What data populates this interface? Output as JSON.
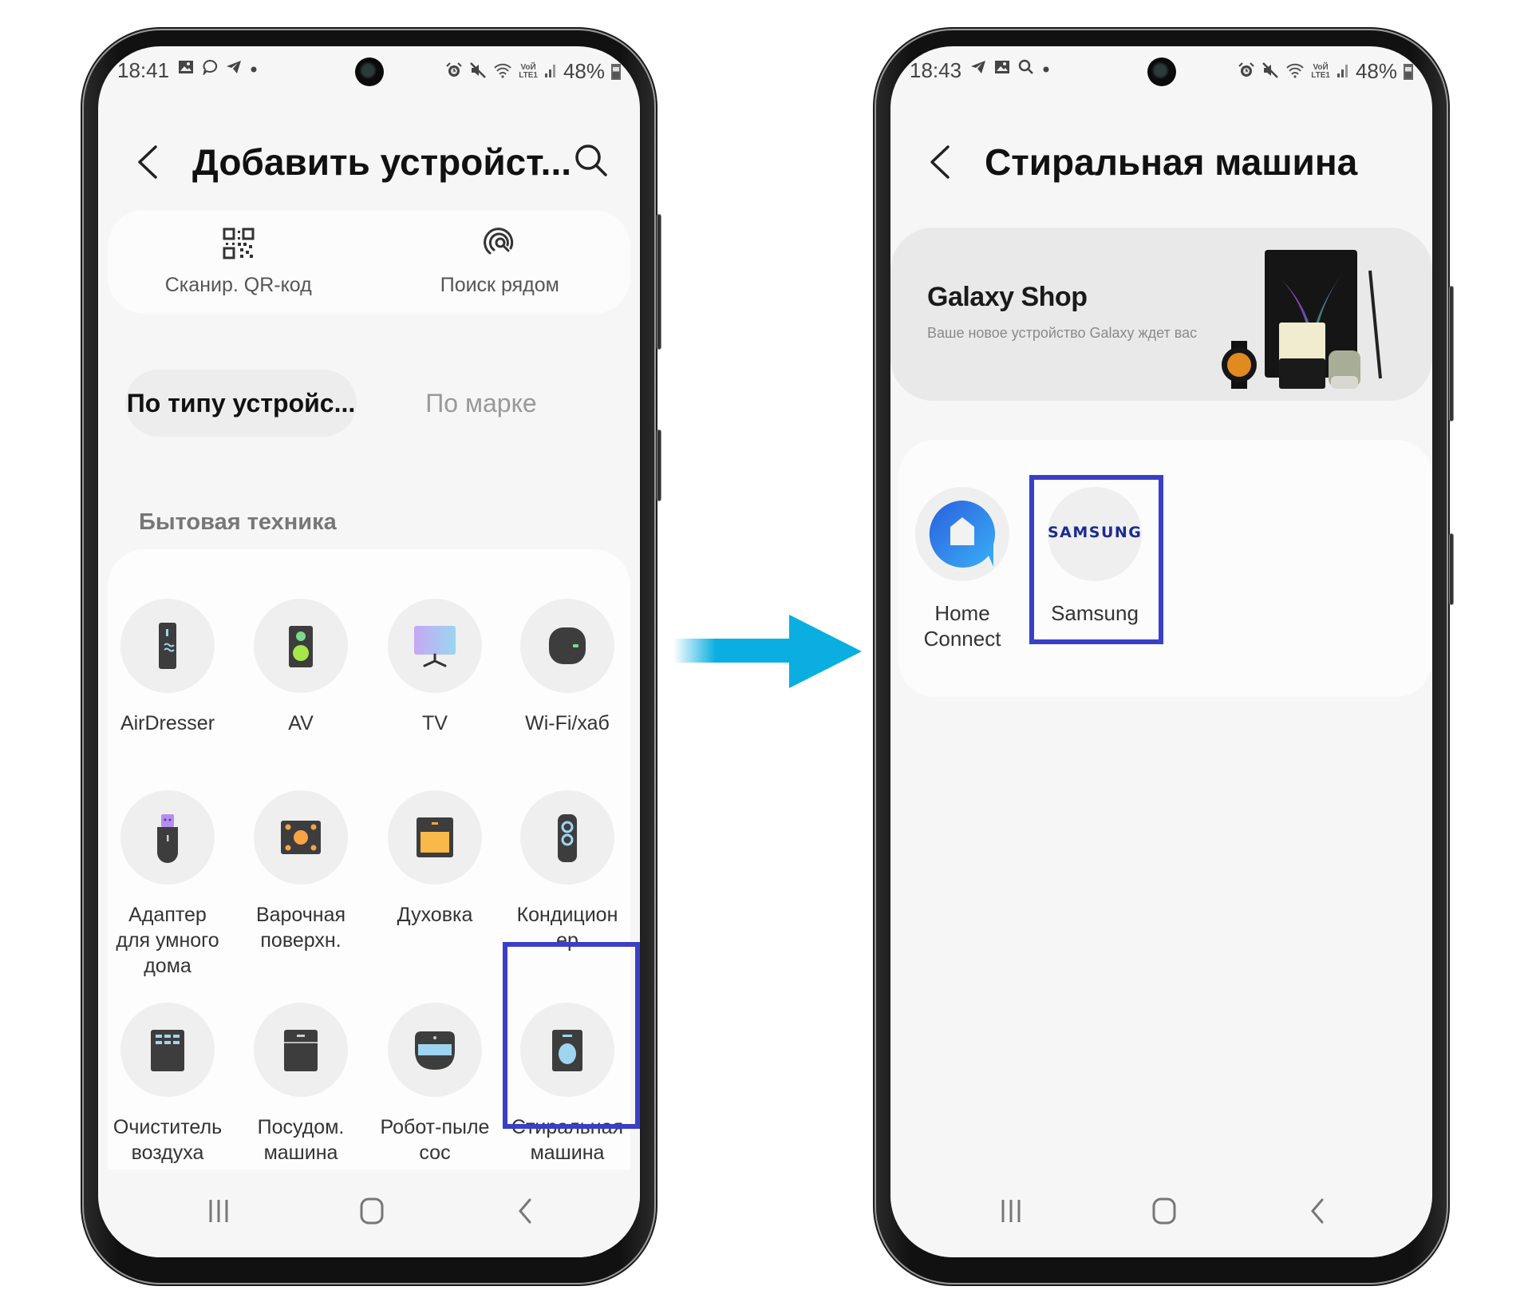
{
  "left_phone": {
    "status": {
      "time": "18:41",
      "left_icons": [
        "gallery-icon",
        "chat-bubble-icon",
        "telegram-icon",
        "dot-icon"
      ],
      "right_icons": [
        "alarm-icon",
        "mute-icon",
        "wifi-icon",
        "volte-lte-icon",
        "signal-icon"
      ],
      "volte_label_top": "VoЙ",
      "volte_label_bottom": "LTE1",
      "battery": "48%"
    },
    "header": {
      "title": "Добавить устройст..."
    },
    "quick_actions": [
      {
        "label": "Сканир. QR-код",
        "icon": "qr-code-icon"
      },
      {
        "label": "Поиск рядом",
        "icon": "nearby-scan-icon"
      }
    ],
    "tabs": [
      {
        "label": "По типу устройс...",
        "active": true
      },
      {
        "label": "По марке",
        "active": false
      }
    ],
    "section_label": "Бытовая техника",
    "devices": [
      {
        "label": "AirDresser",
        "icon": "airdresser-icon"
      },
      {
        "label": "AV",
        "icon": "speaker-icon"
      },
      {
        "label": "TV",
        "icon": "tv-icon"
      },
      {
        "label": "Wi-Fi/хаб",
        "icon": "wifi-hub-icon"
      },
      {
        "label": "Адаптер для умного дома",
        "icon": "smart-adapter-icon"
      },
      {
        "label": "Варочная поверхн.",
        "icon": "cooktop-icon"
      },
      {
        "label": "Духовка",
        "icon": "oven-icon"
      },
      {
        "label": "Кондиционер",
        "icon": "air-conditioner-icon"
      },
      {
        "label": "Очиститель воздуха",
        "icon": "air-purifier-icon"
      },
      {
        "label": "Посудом. машина",
        "icon": "dishwasher-icon"
      },
      {
        "label": "Робот-пылесос",
        "icon": "robot-vacuum-icon"
      },
      {
        "label": "Стиральная машина",
        "icon": "washing-machine-icon",
        "highlighted": true
      }
    ],
    "device_label_lines": [
      [
        "AirDresser"
      ],
      [
        "AV"
      ],
      [
        "TV"
      ],
      [
        "Wi-Fi/хаб"
      ],
      [
        "Адаптер",
        "для умного",
        "дома"
      ],
      [
        "Варочная",
        "поверхн."
      ],
      [
        "Духовка"
      ],
      [
        "Кондицион",
        "ер"
      ],
      [
        "Очиститель",
        "воздуха"
      ],
      [
        "Посудом.",
        "машина"
      ],
      [
        "Робот-пыле",
        "сос"
      ],
      [
        "Стиральная",
        "машина"
      ]
    ]
  },
  "right_phone": {
    "status": {
      "time": "18:43",
      "left_icons": [
        "telegram-icon",
        "gallery-icon",
        "search-icon",
        "dot-icon"
      ],
      "right_icons": [
        "alarm-icon",
        "mute-icon",
        "wifi-icon",
        "volte-lte-icon",
        "signal-icon"
      ],
      "volte_label_top": "VoЙ",
      "volte_label_bottom": "LTE1",
      "battery": "48%"
    },
    "header": {
      "title": "Стиральная машина"
    },
    "promo": {
      "title": "Galaxy Shop",
      "subtitle": "Ваше новое устройство Galaxy ждет вас"
    },
    "brands": [
      {
        "label_lines": [
          "Home",
          "Connect"
        ],
        "icon": "home-connect-logo"
      },
      {
        "label_lines": [
          "Samsung"
        ],
        "logo_text": "SAMSUNG",
        "icon": "samsung-logo",
        "highlighted": true
      }
    ]
  },
  "colors": {
    "highlight_border": "#3a3fc6",
    "arrow": "#0aaee0",
    "samsung_blue": "#1d2b8f",
    "home_connect_blue": "#2f7be6"
  }
}
